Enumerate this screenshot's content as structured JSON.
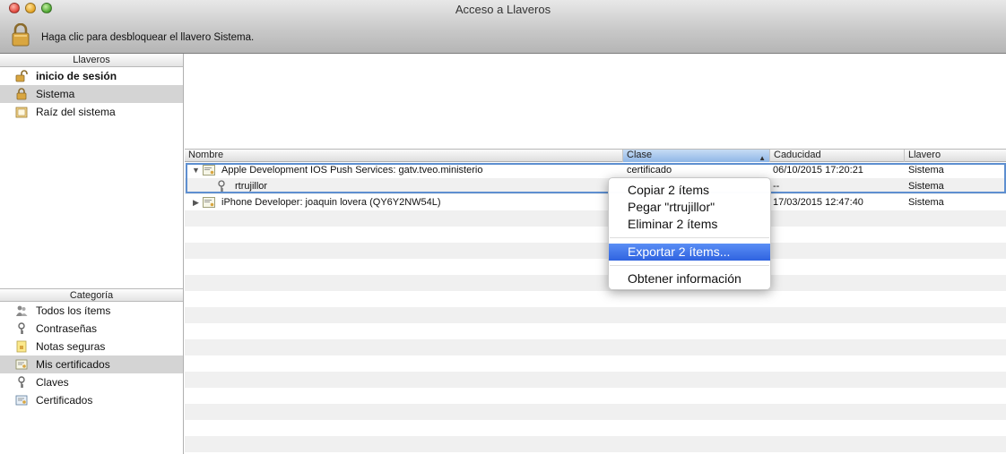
{
  "window": {
    "title": "Acceso a Llaveros"
  },
  "toolbar": {
    "lock_text": "Haga clic para desbloquear el llavero Sistema."
  },
  "keychains": {
    "header": "Llaveros",
    "items": [
      {
        "label": "inicio de sesión",
        "icon": "unlocked-padlock-icon"
      },
      {
        "label": "Sistema",
        "icon": "locked-padlock-icon"
      },
      {
        "label": "Raíz del sistema",
        "icon": "folder-icon"
      }
    ]
  },
  "category": {
    "header": "Categoría",
    "items": [
      {
        "label": "Todos los ítems",
        "icon": "people-icon"
      },
      {
        "label": "Contraseñas",
        "icon": "key-icon"
      },
      {
        "label": "Notas seguras",
        "icon": "note-icon"
      },
      {
        "label": "Mis certificados",
        "icon": "certificate-icon"
      },
      {
        "label": "Claves",
        "icon": "key-icon"
      },
      {
        "label": "Certificados",
        "icon": "certificate-icon"
      }
    ]
  },
  "table": {
    "columns": [
      "Nombre",
      "Clase",
      "Caducidad",
      "Llavero"
    ],
    "sorted_column": "Clase",
    "rows": [
      {
        "name": "Apple Development IOS Push Services: gatv.tveo.ministerio",
        "class": "certificado",
        "expires": "06/10/2015 17:20:21",
        "keychain": "Sistema"
      },
      {
        "name": "rtrujillor",
        "class": "",
        "expires": "--",
        "keychain": "Sistema"
      },
      {
        "name": "iPhone Developer: joaquin lovera (QY6Y2NW54L)",
        "class": "",
        "expires": "17/03/2015 12:47:40",
        "keychain": "Sistema"
      }
    ]
  },
  "context_menu": {
    "items": [
      "Copiar 2 ítems",
      "Pegar \"rtrujillor\"",
      "Eliminar 2 ítems",
      "Exportar 2 ítems...",
      "Obtener información"
    ],
    "highlighted": "Exportar 2 ítems..."
  },
  "colors": {
    "selection_blue": "#2f63e0",
    "outline_blue": "#5e8fd0"
  }
}
